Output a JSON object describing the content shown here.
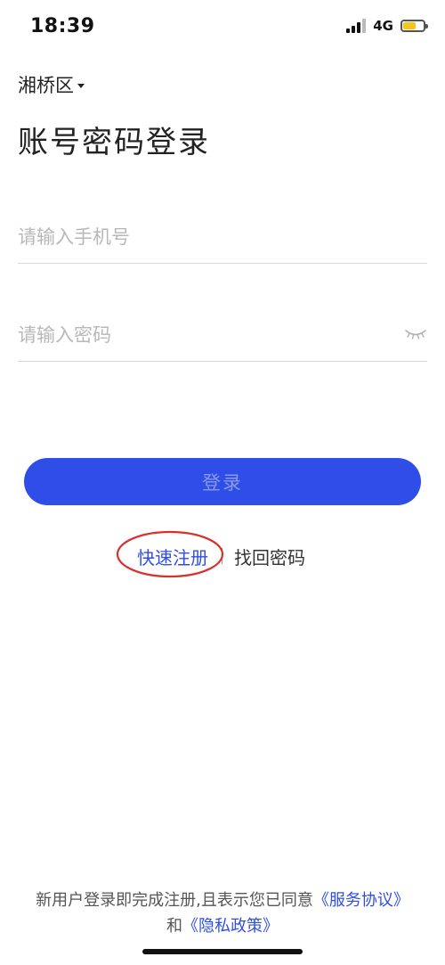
{
  "status_bar": {
    "time": "18:39",
    "network": "4G",
    "battery_color": "#f5c518"
  },
  "region": {
    "label": "湘桥区"
  },
  "page": {
    "title": "账号密码登录"
  },
  "form": {
    "phone_placeholder": "请输入手机号",
    "phone_value": "",
    "password_placeholder": "请输入密码",
    "password_value": "",
    "login_label": "登录"
  },
  "links": {
    "register": "快速注册",
    "find_password": "找回密码"
  },
  "agreement": {
    "text_prefix": "新用户登录即完成注册,且表示您已同意",
    "service_link": "《服务协议》",
    "joiner": "和",
    "privacy_link": "《隐私政策》"
  },
  "colors": {
    "accent": "#2f4ee8",
    "annotation": "#d9302c"
  }
}
